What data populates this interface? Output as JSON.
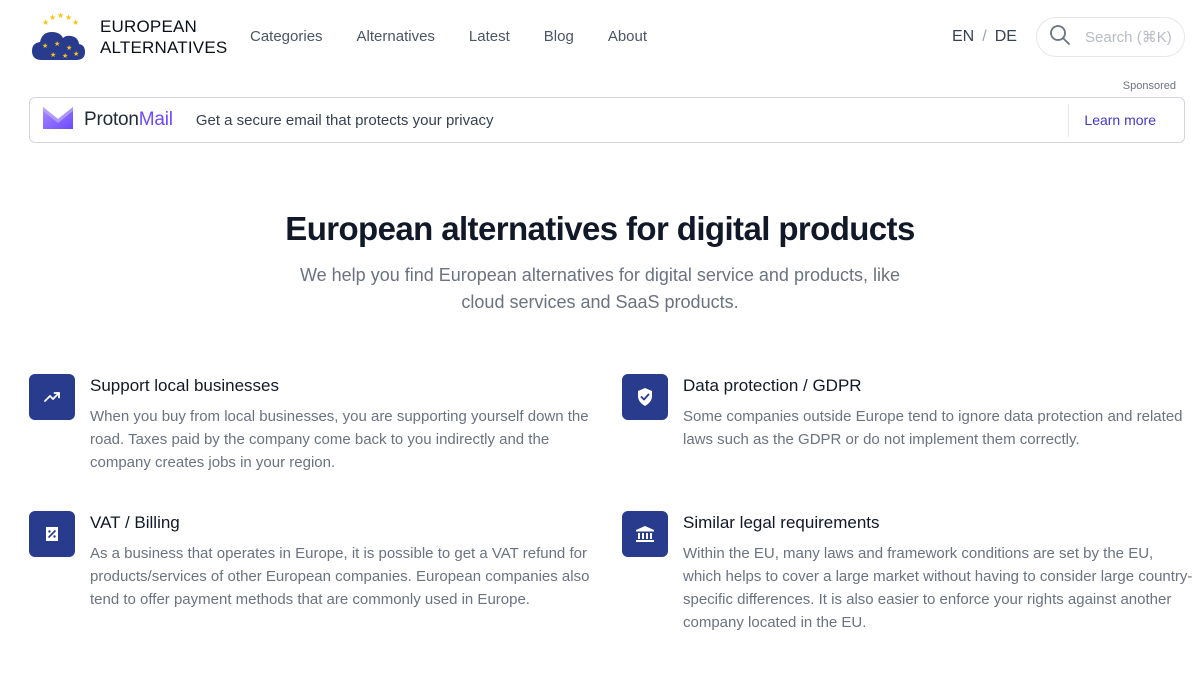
{
  "header": {
    "logo_line1": "EUROPEAN",
    "logo_line2": "ALTERNATIVES",
    "nav": [
      "Categories",
      "Alternatives",
      "Latest",
      "Blog",
      "About"
    ],
    "lang_en": "EN",
    "lang_sep": "/",
    "lang_de": "DE",
    "search_placeholder": "Search (⌘K)"
  },
  "sponsor": {
    "label": "Sponsored",
    "brand_first": "Proton",
    "brand_second": "Mail",
    "text": "Get a secure email that protects your privacy",
    "cta": "Learn more"
  },
  "hero": {
    "title": "European alternatives for digital products",
    "subtitle": "We help you find European alternatives for digital service and products, like cloud services and SaaS products."
  },
  "features": [
    {
      "title": "Support local businesses",
      "text": "When you buy from local businesses, you are supporting yourself down the road. Taxes paid by the company come back to you indirectly and the company creates jobs in your region.",
      "icon": "trending-up-icon"
    },
    {
      "title": "Data protection / GDPR",
      "text": "Some companies outside Europe tend to ignore data protection and related laws such as the GDPR or do not implement them correctly.",
      "icon": "shield-check-icon"
    },
    {
      "title": "VAT / Billing",
      "text": "As a business that operates in Europe, it is possible to get a VAT refund for products/services of other European companies. European companies also tend to offer payment methods that are commonly used in Europe.",
      "icon": "receipt-percent-icon"
    },
    {
      "title": "Similar legal requirements",
      "text": "Within the EU, many laws and framework conditions are set by the EU, which helps to cover a large market without having to consider large country-specific differences. It is also easier to enforce your rights against another company located in the EU.",
      "icon": "building-library-icon"
    }
  ],
  "colors": {
    "accent": "#283b8c",
    "proton_purple": "#6d4aff",
    "link": "#4338ca",
    "star_yellow": "#f5c518"
  }
}
